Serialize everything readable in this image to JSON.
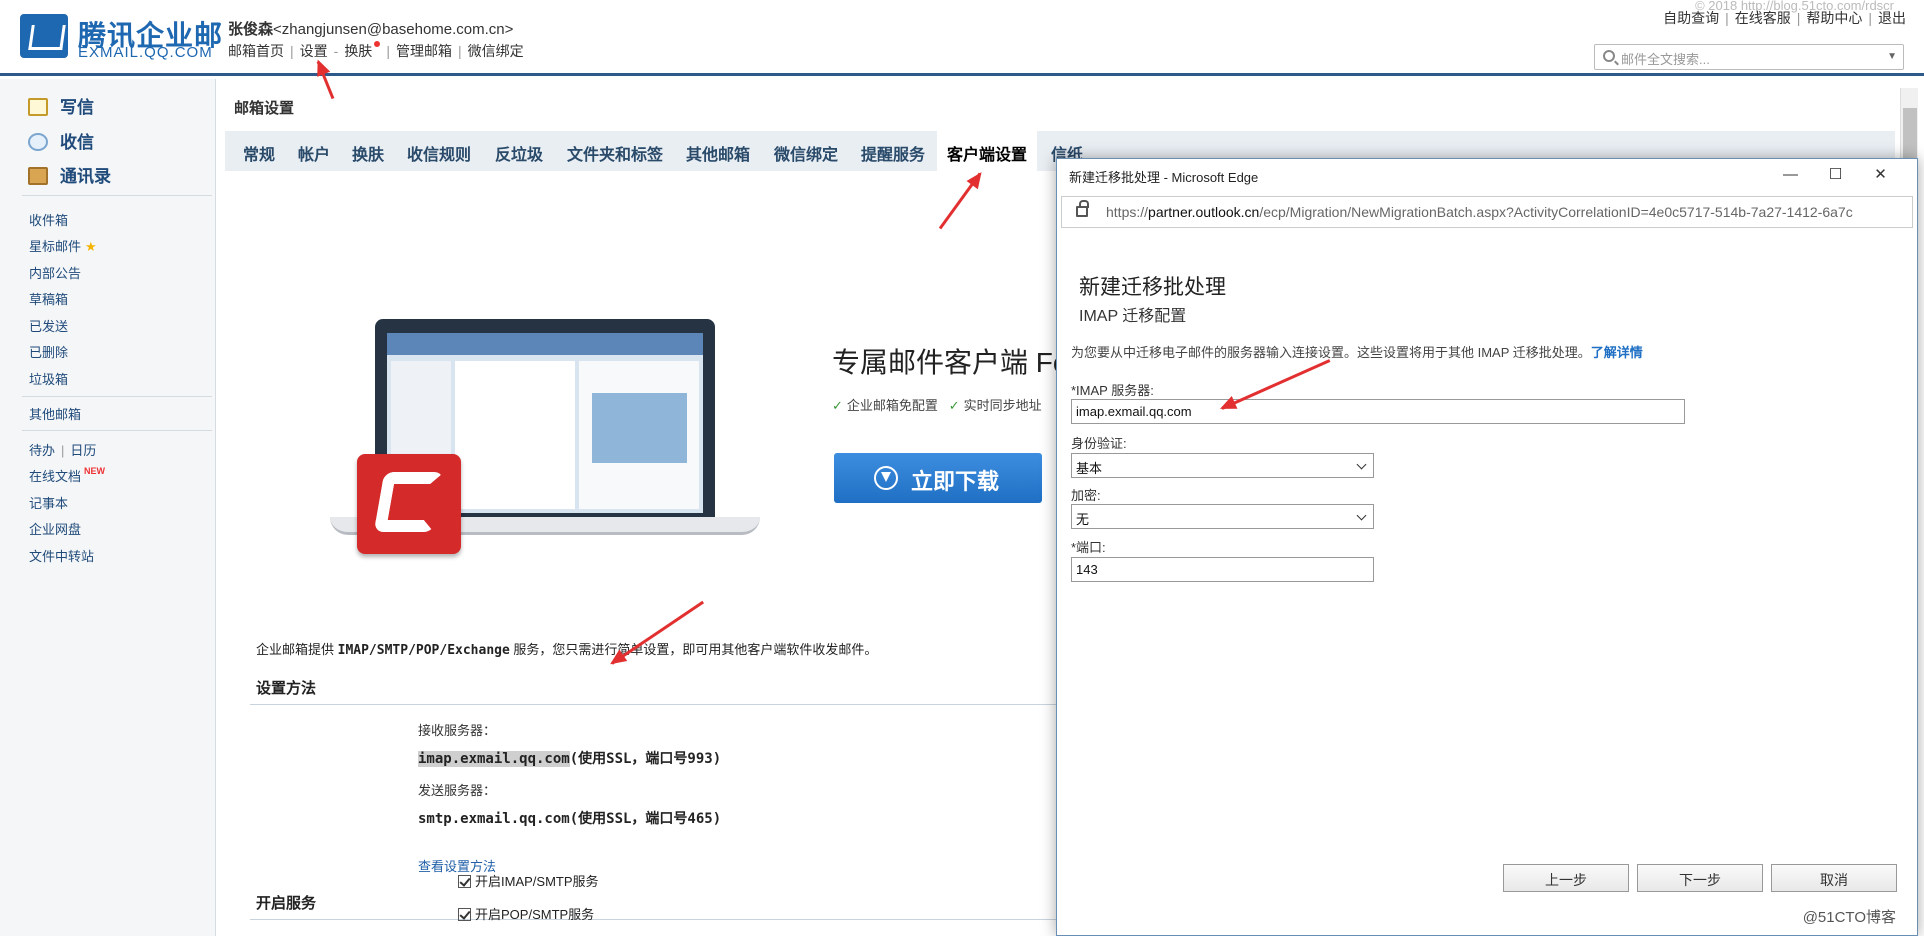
{
  "header": {
    "logo_cn": "腾讯企业邮",
    "logo_en": "EXMAIL.QQ.COM",
    "user_name": "张俊森",
    "user_email": "<zhangjunsen@basehome.com.cn>",
    "nav": [
      "邮箱首页",
      "设置",
      "换肤",
      "管理邮箱",
      "微信绑定"
    ],
    "top_links": [
      "自助查询",
      "在线客服",
      "帮助中心",
      "退出"
    ],
    "watermark": "© 2018 http://blog.51cto.com/rdscr",
    "search_placeholder": "邮件全文搜索..."
  },
  "sidebar": {
    "compose": "写信",
    "inbox": "收信",
    "contacts": "通讯录",
    "folders": [
      "收件箱",
      "星标邮件",
      "内部公告",
      "草稿箱",
      "已发送",
      "已删除",
      "垃圾箱"
    ],
    "other_mail": "其他邮箱",
    "todo": "待办",
    "calendar": "日历",
    "tools": [
      "在线文档",
      "记事本",
      "企业网盘",
      "文件中转站"
    ],
    "new_badge": "NEW"
  },
  "main": {
    "title": "邮箱设置",
    "tabs": [
      "常规",
      "帐户",
      "换肤",
      "收信规则",
      "反垃圾",
      "文件夹和标签",
      "其他邮箱",
      "微信绑定",
      "提醒服务",
      "客户端设置",
      "信纸"
    ],
    "active_tab": "客户端设置",
    "promo_title": "专属邮件客户端 Fo",
    "promo_checks": [
      "企业邮箱免配置",
      "实时同步地址"
    ],
    "download_label": "立即下载",
    "desc_prefix": "企业邮箱提供 ",
    "desc_protocols": "IMAP/SMTP/POP/Exchange",
    "desc_suffix": " 服务，您只需进行简单设置，即可用其他客户端软件收发邮件。",
    "setup_title": "设置方法",
    "recv_label": "接收服务器：",
    "recv_host": "imap.exmail.qq.com",
    "recv_note": "(使用SSL，端口号993)",
    "send_label": "发送服务器：",
    "send_value": "smtp.exmail.qq.com(使用SSL，端口号465)",
    "view_link": "查看设置方法",
    "service_title": "开启服务",
    "services": [
      "开启IMAP/SMTP服务",
      "开启POP/SMTP服务"
    ]
  },
  "edge_popup": {
    "window_title": "新建迁移批处理 - Microsoft Edge",
    "controls": [
      "—",
      "☐",
      "✕"
    ],
    "url_prefix": "https://",
    "url_host": "partner.outlook.cn",
    "url_path": "/ecp/Migration/NewMigrationBatch.aspx?ActivityCorrelationID=4e0c5717-514b-7a27-1412-6a7c",
    "heading": "新建迁移批处理",
    "subheading": "IMAP 迁移配置",
    "description": "为您要从中迁移电子邮件的服务器输入连接设置。这些设置将用于其他 IMAP 迁移批处理。",
    "learn_more": "了解详情",
    "imap_label": "*IMAP 服务器:",
    "imap_value": "imap.exmail.qq.com",
    "auth_label": "身份验证:",
    "auth_value": "基本",
    "enc_label": "加密:",
    "enc_value": "无",
    "port_label": "*端口:",
    "port_value": "143",
    "btn_back": "上一步",
    "btn_next": "下一步",
    "btn_cancel": "取消"
  },
  "watermark_bottom": "@51CTO博客"
}
